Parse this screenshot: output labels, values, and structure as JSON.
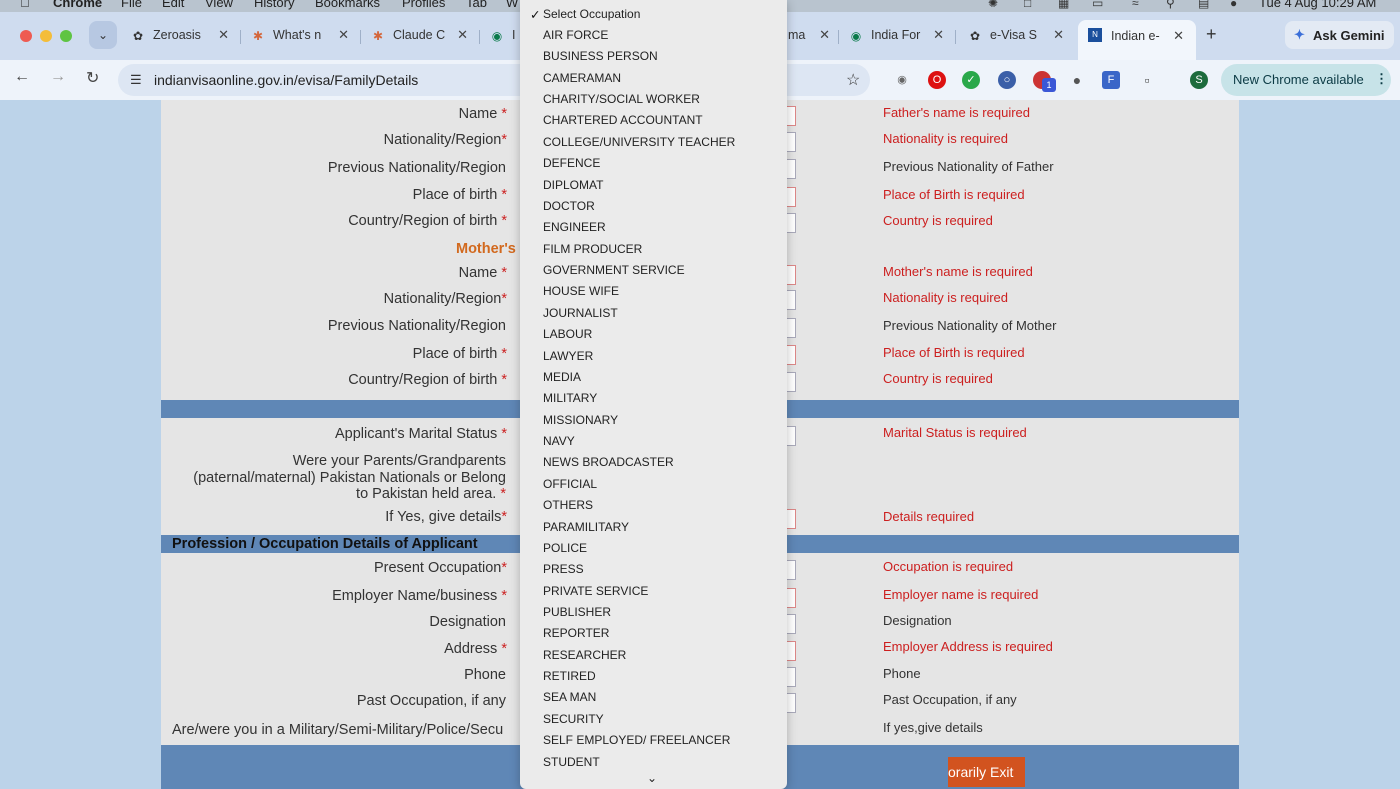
{
  "menubar": {
    "app": "Chrome",
    "items": [
      "File",
      "Edit",
      "View",
      "History",
      "Bookmarks",
      "Profiles",
      "Tab",
      "W"
    ],
    "clock": "Tue 4 Aug  10:29 AM"
  },
  "tabs": [
    {
      "label": "Zeroasis",
      "icon": "openai-icon"
    },
    {
      "label": "What's n",
      "icon": "claude-icon"
    },
    {
      "label": "Claude C",
      "icon": "claude-icon"
    },
    {
      "label": "I",
      "icon": "tripadvisor-icon"
    },
    {
      "label": "ma",
      "icon": "generic-icon"
    },
    {
      "label": "India For",
      "icon": "tripadvisor-icon"
    },
    {
      "label": "e-Visa S",
      "icon": "openai-icon"
    },
    {
      "label": "Indian e-",
      "icon": "nic-icon",
      "active": true
    }
  ],
  "ask_gemini": "Ask Gemini",
  "address_bar": {
    "url": "indianvisaonline.gov.in/evisa/FamilyDetails"
  },
  "new_chrome": "New Chrome available",
  "avatar_initial": "S",
  "extension_badge": "1",
  "form": {
    "father": [
      {
        "label": "Name",
        "required": true,
        "msg": "Father's name is required",
        "msg_type": "error"
      },
      {
        "label": "Nationality/Region",
        "required": true,
        "msg": "Nationality is required",
        "msg_type": "error"
      },
      {
        "label": "Previous Nationality/Region",
        "required": false,
        "msg": "Previous Nationality of Father",
        "msg_type": "hint"
      },
      {
        "label": "Place of birth",
        "required": true,
        "msg": "Place of Birth is required",
        "msg_type": "error"
      },
      {
        "label": "Country/Region of birth",
        "required": true,
        "msg": "Country is required",
        "msg_type": "error"
      }
    ],
    "mothers_heading": "Mother's",
    "mother": [
      {
        "label": "Name",
        "required": true,
        "msg": "Mother's name is required",
        "msg_type": "error"
      },
      {
        "label": "Nationality/Region",
        "required": true,
        "msg": "Nationality is required",
        "msg_type": "error"
      },
      {
        "label": "Previous Nationality/Region",
        "required": false,
        "msg": "Previous Nationality of Mother",
        "msg_type": "hint"
      },
      {
        "label": "Place of birth",
        "required": true,
        "msg": "Place of Birth is required",
        "msg_type": "error"
      },
      {
        "label": "Country/Region of birth",
        "required": true,
        "msg": "Country is required",
        "msg_type": "error"
      }
    ],
    "marital_label": "Applicant's Marital Status",
    "marital_msg": "Marital Status is required",
    "pakistan_label_1": "Were your Parents/Grandparents",
    "pakistan_label_2": "(paternal/maternal) Pakistan Nationals or Belong",
    "pakistan_label_3": "to Pakistan held area.",
    "yes_details_label": "If Yes, give details",
    "yes_details_msg": "Details required",
    "profession_heading": "Profession / Occupation Details of Applicant",
    "profession": [
      {
        "label": "Present Occupation",
        "required": true,
        "msg": "Occupation is required",
        "msg_type": "error"
      },
      {
        "label": "Employer Name/business",
        "required": true,
        "msg": "Employer name is required",
        "msg_type": "error"
      },
      {
        "label": "Designation",
        "required": false,
        "msg": "Designation",
        "msg_type": "hint"
      },
      {
        "label": "Address",
        "required": true,
        "msg": "Employer Address is required",
        "msg_type": "error"
      },
      {
        "label": "Phone",
        "required": false,
        "msg": "Phone",
        "msg_type": "hint"
      },
      {
        "label": "Past Occupation, if any",
        "required": false,
        "msg": "Past Occupation, if any",
        "msg_type": "hint"
      }
    ],
    "military_label": "Are/were you in a Military/Semi-Military/Police/Secu",
    "military_msg": "If yes,give details",
    "exit_button": "orarily Exit"
  },
  "occupation_dropdown": {
    "selected": "Select Occupation",
    "options": [
      "AIR FORCE",
      "BUSINESS PERSON",
      "CAMERAMAN",
      "CHARITY/SOCIAL WORKER",
      "CHARTERED ACCOUNTANT",
      "COLLEGE/UNIVERSITY TEACHER",
      "DEFENCE",
      "DIPLOMAT",
      "DOCTOR",
      "ENGINEER",
      "FILM PRODUCER",
      "GOVERNMENT SERVICE",
      "HOUSE WIFE",
      "JOURNALIST",
      "LABOUR",
      "LAWYER",
      "MEDIA",
      "MILITARY",
      "MISSIONARY",
      "NAVY",
      "NEWS BROADCASTER",
      "OFFICIAL",
      "OTHERS",
      "PARAMILITARY",
      "POLICE",
      "PRESS",
      "PRIVATE SERVICE",
      "PUBLISHER",
      "REPORTER",
      "RESEARCHER",
      "RETIRED",
      "SEA MAN",
      "SECURITY",
      "SELF EMPLOYED/ FREELANCER",
      "STUDENT"
    ]
  },
  "colors": {
    "error": "#cc1f1f",
    "accent_bar": "#5f87b6",
    "mother_heading": "#d2691e",
    "exit_button": "#d2531f"
  }
}
